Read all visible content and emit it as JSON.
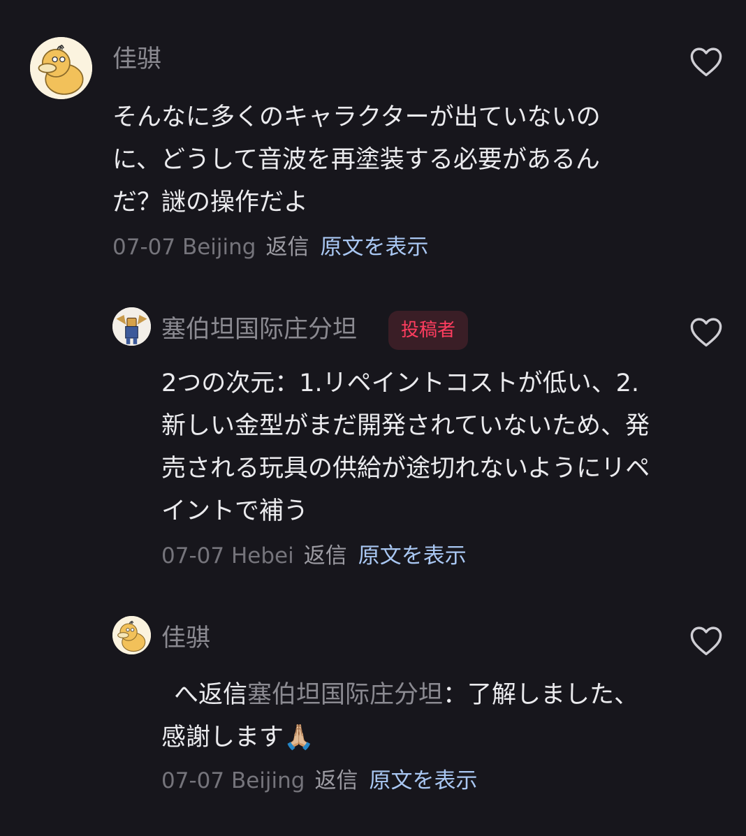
{
  "comments": [
    {
      "username": "佳骐",
      "text": "そんなに多くのキャラクターが出ていないのに、どうして音波を再塗装する必要があるんだ？謎の操作だよ",
      "date": "07-07",
      "location": "Beijing",
      "reply_label": "返信",
      "translate_label": "原文を表示",
      "avatar_icon": "psyduck-avatar-icon",
      "like_icon": "heart-outline-icon"
    },
    {
      "username": "塞伯坦国际庄分坦",
      "badge": "投稿者",
      "text": "2つの次元：1.リペイントコストが低い、2.新しい金型がまだ開発されていないため、発売される玩具の供給が途切れないようにリペイントで補う",
      "date": "07-07",
      "location": "Hebei",
      "reply_label": "返信",
      "translate_label": "原文を表示",
      "avatar_icon": "robot-character-avatar-icon",
      "like_icon": "heart-outline-icon"
    },
    {
      "username": "佳骐",
      "text_prefix": "へ返信",
      "mention": "塞伯坦国际庄分坦",
      "text_suffix": "：了解しました、感謝します🙏🏼",
      "date": "07-07",
      "location": "Beijing",
      "reply_label": "返信",
      "translate_label": "原文を表示",
      "avatar_icon": "psyduck-avatar-icon",
      "like_icon": "heart-outline-icon"
    }
  ],
  "colors": {
    "background": "#17161c",
    "text": "#ebebee",
    "muted": "#8b8a91",
    "link": "#a9c7f2",
    "badge_text": "#ff3d5f",
    "badge_bg": "#3a1e26"
  }
}
